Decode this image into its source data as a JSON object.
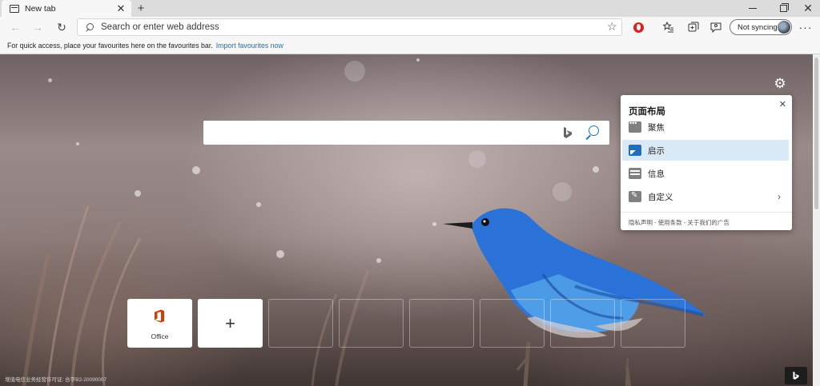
{
  "tab": {
    "title": "New tab",
    "icon": "newtab-page-icon"
  },
  "window_controls": [
    "minimize-icon",
    "maximize-icon",
    "close-icon"
  ],
  "toolbar": {
    "address_placeholder": "Search or enter web address",
    "sync_label": "Not syncing",
    "icons": [
      "back-icon",
      "forward-icon",
      "refresh-icon",
      "favorite-star-icon",
      "opera-extension-icon",
      "favorites-icon",
      "collections-icon",
      "feedback-icon",
      "more-icon"
    ]
  },
  "favbar": {
    "message": "For quick access, place your favourites here on the favourites bar.",
    "link": "Import favourites now"
  },
  "layout_popup": {
    "title": "页面布局",
    "options": [
      {
        "label": "聚焦",
        "icon": "focused-layout-icon"
      },
      {
        "label": "启示",
        "icon": "inspirational-layout-icon",
        "selected": true
      },
      {
        "label": "信息",
        "icon": "informational-layout-icon"
      },
      {
        "label": "自定义",
        "icon": "custom-layout-icon"
      }
    ],
    "footer": "隐私声明 - 使用条款 - 关于我们的广告"
  },
  "tiles": [
    {
      "label": "Office",
      "icon": "office-logo"
    },
    {
      "label": "",
      "icon": "add-site-icon"
    }
  ],
  "footer": {
    "license": "增值电信业务经营许可证: 合字B2-20090007"
  },
  "colors": {
    "accent": "#1478c8",
    "selected_option_bg": "#d9e9f6",
    "office_red": "#d83b01"
  }
}
